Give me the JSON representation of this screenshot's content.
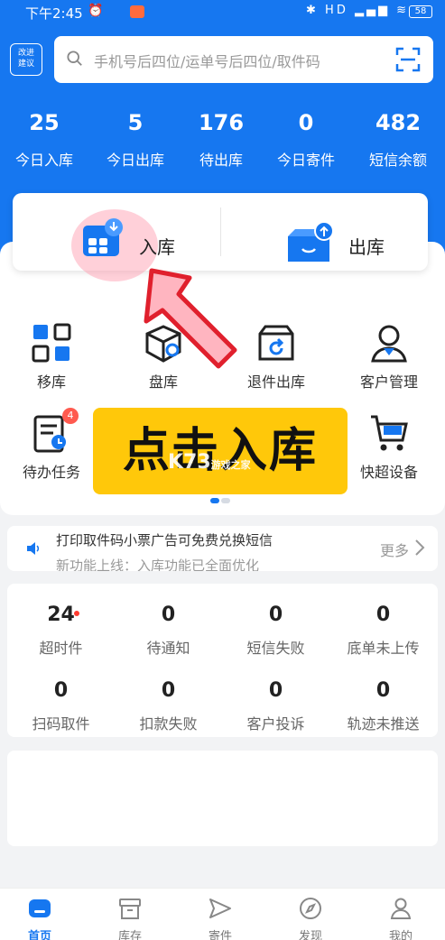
{
  "status_bar": {
    "time": "下午2:45",
    "battery": "58",
    "network_label": "HD"
  },
  "header": {
    "suggest_line1": "改进",
    "suggest_line2": "建议",
    "search_placeholder": "手机号后四位/运单号后四位/取件码"
  },
  "stats": [
    {
      "value": "25",
      "label": "今日入库"
    },
    {
      "value": "5",
      "label": "今日出库"
    },
    {
      "value": "176",
      "label": "待出库"
    },
    {
      "value": "0",
      "label": "今日寄件"
    },
    {
      "value": "482",
      "label": "短信余额"
    }
  ],
  "main_actions": {
    "inbound": "入库",
    "outbound": "出库"
  },
  "grid": [
    {
      "label": "移库",
      "icon": "move-stock-icon"
    },
    {
      "label": "盘库",
      "icon": "inventory-check-icon"
    },
    {
      "label": "退件出库",
      "icon": "return-outbound-icon"
    },
    {
      "label": "客户管理",
      "icon": "customer-icon"
    },
    {
      "label": "待办任务",
      "icon": "todo-icon",
      "badge": "4"
    },
    {
      "label": "快超设备",
      "icon": "cart-icon"
    }
  ],
  "overlay": {
    "banner_text": "点击入库",
    "watermark_main": "K73",
    "watermark_sub": "游戏之家"
  },
  "notice": {
    "text": "打印取件码小票广告可免费兑换短信",
    "text2": "新功能上线：入库功能已全面优化",
    "more": "更多"
  },
  "counts": [
    {
      "value": "24",
      "label": "超时件"
    },
    {
      "value": "0",
      "label": "待通知"
    },
    {
      "value": "0",
      "label": "短信失败"
    },
    {
      "value": "0",
      "label": "底单未上传"
    },
    {
      "value": "0",
      "label": "扫码取件"
    },
    {
      "value": "0",
      "label": "扣款失败"
    },
    {
      "value": "0",
      "label": "客户投诉"
    },
    {
      "value": "0",
      "label": "轨迹未推送"
    }
  ],
  "tabbar": [
    {
      "label": "首页"
    },
    {
      "label": "库存"
    },
    {
      "label": "寄件"
    },
    {
      "label": "发现"
    },
    {
      "label": "我的"
    }
  ],
  "colors": {
    "primary": "#1677f0",
    "banner": "#ffc80a",
    "badge": "#ff5a4f"
  }
}
